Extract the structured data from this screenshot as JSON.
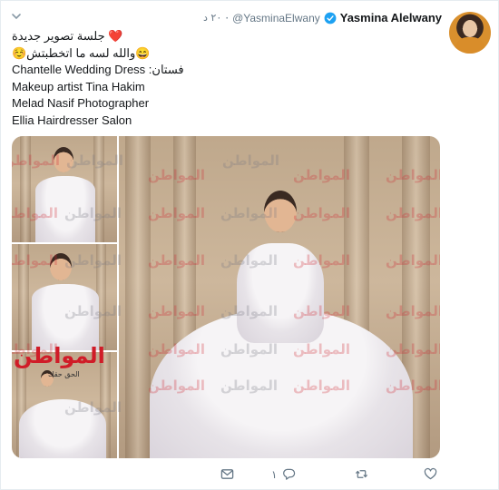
{
  "tweet": {
    "author": {
      "display_name": "Yasmina Alelwany",
      "handle": "@YasminaElwany",
      "avatar_icon": "profile-photo",
      "verified": true
    },
    "date": "٢٠ د",
    "separator": "·",
    "text_lines": [
      "❤️ جلسة تصوير جديدة",
      "😄والله لسه ما اتخطبتش☺️",
      "فستان: Chantelle Wedding Dress",
      "Makeup artist Tina Hakim",
      "Melad Nasif Photographer",
      "Ellia Hairdresser Salon"
    ],
    "media": {
      "watermark_text": "المواطن",
      "logo_text": "المواطن",
      "logo_subtext": "الحق حقك"
    },
    "actions": {
      "reply_count": "١",
      "icons": [
        "mail-icon",
        "reply-icon",
        "retweet-icon",
        "like-icon"
      ]
    }
  },
  "colors": {
    "verified_blue": "#1da1f2",
    "text_primary": "#14171a",
    "text_secondary": "#657786",
    "watermark_red": "#d01c28"
  }
}
